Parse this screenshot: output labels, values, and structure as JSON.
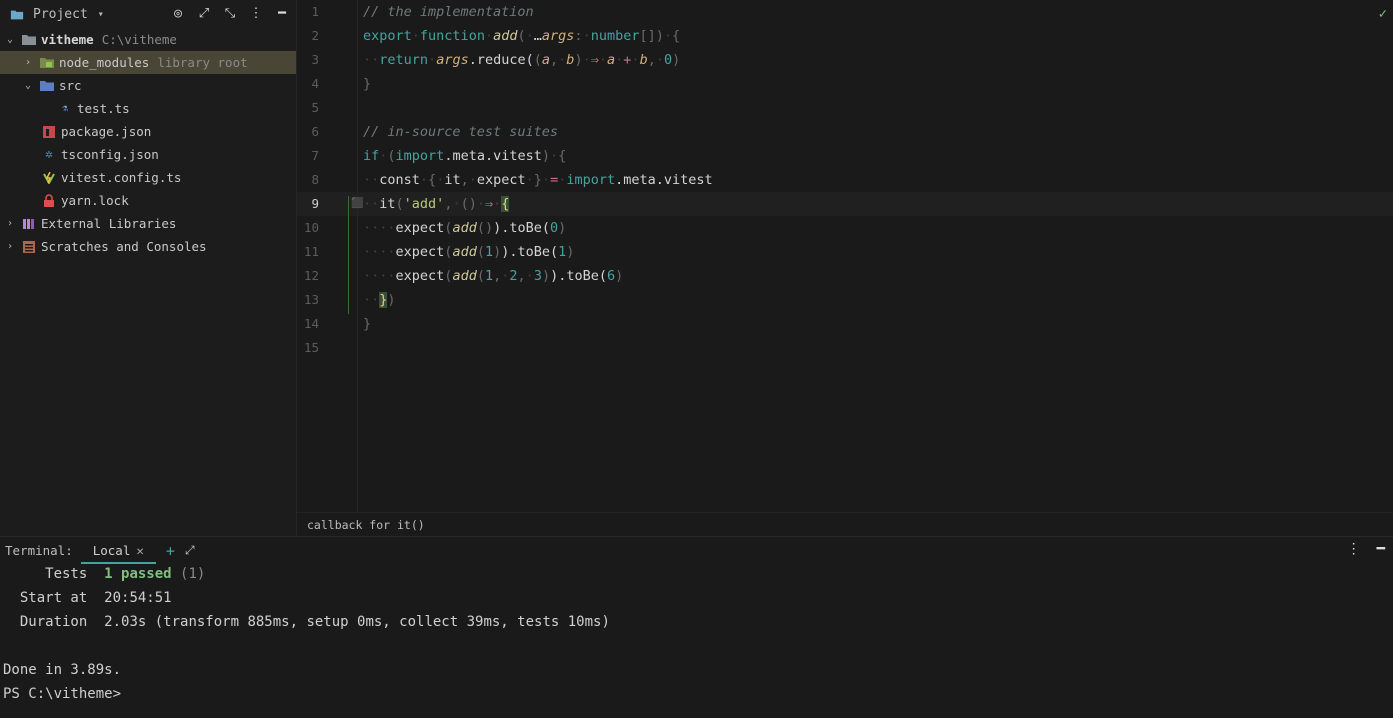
{
  "project": {
    "title": "Project",
    "icons": [
      "target-icon",
      "expand-icon",
      "collapse-icon",
      "more-icon",
      "minimize-icon"
    ],
    "tree": [
      {
        "name": "vitheme",
        "extra": "C:\\vitheme",
        "icon": "folder-icon",
        "level": 0,
        "expanded": true
      },
      {
        "name": "node_modules",
        "extra": "library root",
        "icon": "node-modules-folder-icon",
        "level": 1,
        "expanded": false,
        "selected": true
      },
      {
        "name": "src",
        "extra": "",
        "icon": "source-folder-icon",
        "level": 1,
        "expanded": true
      },
      {
        "name": "test.ts",
        "extra": "",
        "icon": "test-file-icon",
        "level": 2
      },
      {
        "name": "package.json",
        "extra": "",
        "icon": "npm-icon",
        "level": 1
      },
      {
        "name": "tsconfig.json",
        "extra": "",
        "icon": "tsconfig-icon",
        "level": 1
      },
      {
        "name": "vitest.config.ts",
        "extra": "",
        "icon": "vitest-icon",
        "level": 1
      },
      {
        "name": "yarn.lock",
        "extra": "",
        "icon": "lock-icon",
        "level": 1
      },
      {
        "name": "External Libraries",
        "extra": "",
        "icon": "library-icon",
        "level": 0,
        "expanded": false
      },
      {
        "name": "Scratches and Consoles",
        "extra": "",
        "icon": "scratches-icon",
        "level": 0,
        "expanded": false
      }
    ]
  },
  "editor": {
    "current_line": 9,
    "line_numbers": [
      "1",
      "2",
      "3",
      "4",
      "5",
      "6",
      "7",
      "8",
      "9",
      "10",
      "11",
      "12",
      "13",
      "14",
      "15"
    ],
    "code": {
      "l1_comment": "// the implementation",
      "l2_export": "export",
      "l2_function": "function",
      "l2_name": "add",
      "l2_paren_open": "(",
      "l2_spread": "…",
      "l2_param": "args",
      "l2_colon": ":",
      "l2_type": "number",
      "l2_brackets": "[]",
      "l2_paren_close": ")",
      "l2_brace": "{",
      "l3_return": "return",
      "l3_args": "args",
      "l3_reduce": ".reduce(",
      "l3_open": "(",
      "l3_a": "a",
      "l3_comma": ",",
      "l3_b": "b",
      "l3_close": ")",
      "l3_arrow": "⇒",
      "l3_a2": "a",
      "l3_plus": "+",
      "l3_b2": "b",
      "l3_comma2": ",",
      "l3_zero": "0",
      "l3_end": ")",
      "l4_brace": "}",
      "l6_comment": "// in-source test suites",
      "l7_if": "if",
      "l7_open": "(",
      "l7_import": "import",
      "l7_meta": ".meta.vitest",
      "l7_close": ")",
      "l7_brace": "{",
      "l8_const": "const",
      "l8_open": "{",
      "l8_it": "it",
      "l8_comma": ",",
      "l8_expect": "expect",
      "l8_close": "}",
      "l8_eq": "=",
      "l8_import": "import",
      "l8_meta": ".meta.vitest",
      "l9_it": "it",
      "l9_open": "(",
      "l9_str": "'add'",
      "l9_comma": ",",
      "l9_parens": "()",
      "l9_arrow": "⇒",
      "l9_brace": "{",
      "l10_expect": "expect",
      "l10_open": "(",
      "l10_add": "add",
      "l10_args": "()",
      "l10_tobe": ").toBe(",
      "l10_val": "0",
      "l10_end": ")",
      "l11_expect": "expect",
      "l11_open": "(",
      "l11_add": "add",
      "l11_args_open": "(",
      "l11_arg": "1",
      "l11_args_close": ")",
      "l11_tobe": ").toBe(",
      "l11_val": "1",
      "l11_end": ")",
      "l12_expect": "expect",
      "l12_open": "(",
      "l12_add": "add",
      "l12_args_open": "(",
      "l12_a1": "1",
      "l12_c1": ",",
      "l12_a2": "2",
      "l12_c2": ",",
      "l12_a3": "3",
      "l12_args_close": ")",
      "l12_tobe": ").toBe(",
      "l12_val": "6",
      "l12_end": ")",
      "l13_brace": "}",
      "l13_paren": ")",
      "l14_brace": "}"
    },
    "breadcrumb": "callback for it()"
  },
  "terminal": {
    "label": "Terminal:",
    "tab": "Local",
    "lines": {
      "tests_label": "     Tests",
      "tests_passed": "1 passed",
      "tests_count": "(1)",
      "start_label": "  Start at",
      "start_value": "20:54:51",
      "duration_label": "  Duration",
      "duration_value": "2.03s (transform 885ms, setup 0ms, collect 39ms, tests 10ms)",
      "done": "Done in 3.89s.",
      "prompt": "PS C:\\vitheme>"
    }
  },
  "colors": {
    "accent": "#46a3a0",
    "selection": "#4a4636",
    "pass": "#7fbf7f"
  }
}
